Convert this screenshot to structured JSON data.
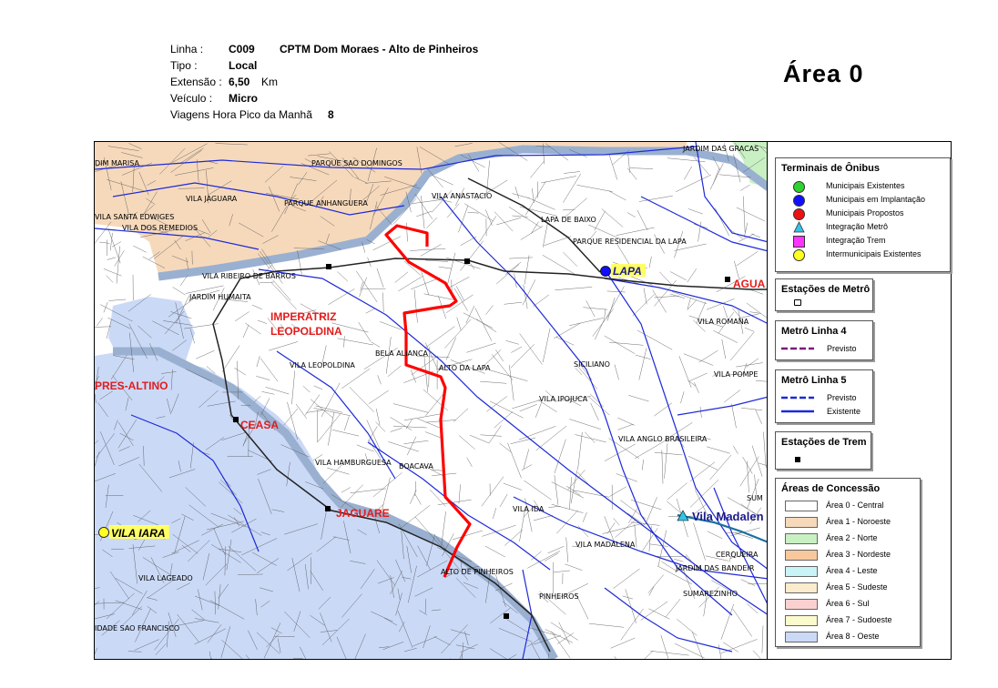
{
  "header": {
    "linha_label": "Linha :",
    "linha_code": "C009",
    "linha_name": "CPTM Dom Moraes - Alto de Pinheiros",
    "tipo_label": "Tipo :",
    "tipo_value": "Local",
    "extensao_label": "Extensão :",
    "extensao_value": "6,50",
    "extensao_unit": "Km",
    "veiculo_label": "Veículo :",
    "veiculo_value": "Micro",
    "viagens_label": "Viagens Hora Pico da Manhã",
    "viagens_value": "8"
  },
  "area_title": "Área  0",
  "colors": {
    "route": "#ff0000",
    "area_central": "#ffffff",
    "area_noroeste": "#f6d9bb",
    "area_norte": "#c9f0c3",
    "area_oeste": "#cad9f6",
    "streets": "#4a4a4a",
    "main_roads": "#1e2ad8",
    "river": "#9ab0d0",
    "rail": "#000000"
  },
  "map": {
    "places": [
      "DIM MARISA",
      "PARQUE SAO DOMINGOS",
      "JARDIM DAS GRACAS",
      "VILA JAGUARA",
      "PARQUE ANHANGUERA",
      "VILA ANASTACIO",
      "VILA SANTA EDWIGES",
      "VILA DOS REMEDIOS",
      "LAPA DE BAIXO",
      "PARQUE RESIDENCIAL DA LAPA",
      "VILA RIBEIRO DE BARROS",
      "JARDIM HUMAITA",
      "VILA ROMANA",
      "BELA ALIANCA",
      "VILA LEOPOLDINA",
      "ALTO DA LAPA",
      "SICILIANO",
      "VILA POMPE",
      "VILA IPOJUCA",
      "VILA ANGLO BRASILEIRA",
      "VILA HAMBURGUESA",
      "BOACAVA",
      "VILA IDA",
      "SUM",
      "VILA MADALENA",
      "CERQUEIRA",
      "JARDIM DAS BANDEIR",
      "ALTO DE PINHEIROS",
      "VILA LAGEADO",
      "PINHEIROS",
      "SUMAREZINHO",
      "IDADE SAO FRANCISCO"
    ],
    "red_labels": [
      "IMPERATRIZ",
      "LEOPOLDINA",
      "PRES-ALTINO",
      "CEASA",
      "JAGUARE",
      "AGUA"
    ],
    "terminals": {
      "lapa": "LAPA",
      "vila_iara": "VILA IARA",
      "vila_madalena": "Vila Madalen"
    }
  },
  "legend": {
    "terminais": {
      "title": "Terminais de Ônibus",
      "items": [
        {
          "label": "Municipais Existentes",
          "color": "#2fd12f",
          "shape": "circle"
        },
        {
          "label": "Municipais em Implantação",
          "color": "#1010ff",
          "shape": "circle"
        },
        {
          "label": "Municipais Propostos",
          "color": "#ee1111",
          "shape": "circle"
        },
        {
          "label": "Integração Metrô",
          "color": "#33c3e8",
          "shape": "triangle"
        },
        {
          "label": "Integração Trem",
          "color": "#ff33ff",
          "shape": "square"
        },
        {
          "label": "Intermunicipais Existentes",
          "color": "#ffff22",
          "shape": "circle"
        }
      ]
    },
    "estacoes_metro": {
      "title": "Estações de Metrô"
    },
    "metro_l4": {
      "title": "Metrô Linha 4",
      "items": [
        {
          "label": "Previsto",
          "color": "#7a1a7a",
          "style": "dashed"
        }
      ]
    },
    "metro_l5": {
      "title": "Metrô Linha 5",
      "items": [
        {
          "label": "Previsto",
          "color": "#1a2ad8",
          "style": "dashed"
        },
        {
          "label": "Existente",
          "color": "#1a2ad8",
          "style": "solid"
        }
      ]
    },
    "estacoes_trem": {
      "title": "Estações de Trem"
    },
    "areas": {
      "title": "Áreas de Concessão",
      "items": [
        {
          "label": "Área 0 - Central",
          "color": "#ffffff"
        },
        {
          "label": "Área 1 - Noroeste",
          "color": "#f6d9bb"
        },
        {
          "label": "Área 2 - Norte",
          "color": "#c9f0c3"
        },
        {
          "label": "Área 3 - Nordeste",
          "color": "#f8c89c"
        },
        {
          "label": "Área 4 - Leste",
          "color": "#c8f4f8"
        },
        {
          "label": "Área 5 - Sudeste",
          "color": "#faeccc"
        },
        {
          "label": "Área 6 - Sul",
          "color": "#fbd0d0"
        },
        {
          "label": "Área 7 - Sudoeste",
          "color": "#fbfacc"
        },
        {
          "label": "Área 8 - Oeste",
          "color": "#cad9f6"
        }
      ]
    }
  }
}
